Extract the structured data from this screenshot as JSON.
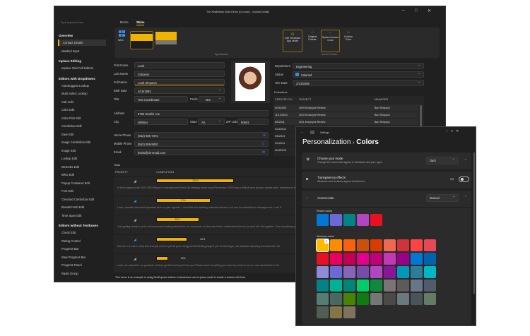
{
  "main": {
    "title": "The XtraEditors Suite Demo (C# code) - Contact Details",
    "search_placeholder": "Type keywords here",
    "sidebar": [
      {
        "type": "h",
        "label": "Overview"
      },
      {
        "type": "i",
        "label": "Contact Details",
        "selected": true
      },
      {
        "type": "i",
        "label": "Masked Input"
      },
      {
        "type": "h",
        "label": "Inplace Editing"
      },
      {
        "type": "i",
        "label": "Inplace Grid Cell Editors"
      },
      {
        "type": "h",
        "label": "Editors with Dropdowns"
      },
      {
        "type": "i",
        "label": "AutoSuggest Lookup"
      },
      {
        "type": "i",
        "label": "Multi Select Lookup"
      },
      {
        "type": "i",
        "label": "Calc Edit"
      },
      {
        "type": "i",
        "label": "Color Edit"
      },
      {
        "type": "i",
        "label": "Color Pick Edit"
      },
      {
        "type": "i",
        "label": "Combobox Edit"
      },
      {
        "type": "i",
        "label": "Date Edit"
      },
      {
        "type": "i",
        "label": "Image Combobox Edit"
      },
      {
        "type": "i",
        "label": "Image Edit"
      },
      {
        "type": "i",
        "label": "Lookup Edit"
      },
      {
        "type": "i",
        "label": "MemoEx Edit"
      },
      {
        "type": "i",
        "label": "MRU Edit"
      },
      {
        "type": "i",
        "label": "Popup Container Edit"
      },
      {
        "type": "i",
        "label": "Font Edit"
      },
      {
        "type": "i",
        "label": "Checked Combobox Edit"
      },
      {
        "type": "i",
        "label": "BreadCrumb Edit"
      },
      {
        "type": "i",
        "label": "Time Span Edit"
      },
      {
        "type": "h",
        "label": "Editors without Textboxes"
      },
      {
        "type": "i",
        "label": "Check Edit"
      },
      {
        "type": "i",
        "label": "Rating Control"
      },
      {
        "type": "i",
        "label": "Progress Bar"
      },
      {
        "type": "i",
        "label": "Step Progress Bar"
      },
      {
        "type": "i",
        "label": "Progress Panel"
      },
      {
        "type": "i",
        "label": "Radio Group"
      }
    ],
    "tabs": [
      "Demo",
      "Skins"
    ],
    "ribbon": {
      "skin_label": "Wi11",
      "appearance": "Appearance",
      "app_mode": "Use Windows App Mode",
      "original_palette": "Original Palette",
      "system_accent": "System Accent Color",
      "custom_color": "Custom Color",
      "accent_colors": "Accent Colors"
    },
    "form": {
      "first_name_label": "First Name",
      "first_name": "Leah",
      "last_name_label": "Last Name",
      "last_name": "Simpson",
      "full_name_label": "Full Name",
      "full_name": "Leah Simpson",
      "birth_date_label": "Birth Date",
      "birth_date": "4/16/1983",
      "title_label": "Title",
      "title": "Test Coordinator",
      "prefix_label": "Prefix",
      "prefix": "Mrs",
      "address_label": "Address",
      "address": "6755 Newlin Ave",
      "city_label": "City",
      "city": "Whittier",
      "state_label": "State",
      "state": "AK",
      "zip_label": "ZIP code",
      "zip": "90601",
      "home_phone_label": "Home Phone",
      "home_phone": "(562) 555-7372",
      "mobile_phone_label": "Mobile Phone",
      "mobile_phone": "(562) 555-5830",
      "email_label": "Email",
      "email": "leahs@dx-email.com",
      "department_label": "Department",
      "department": "Engineering",
      "status_label": "Status",
      "status": "Salaried",
      "hire_date_label": "Hire Date",
      "hire_date": "2/14/2009"
    },
    "evaluations": {
      "label": "Evaluations",
      "columns": [
        "CREATED ON",
        "SUBJECT",
        "MANAGER"
      ],
      "rows": [
        [
          "9/19/2009",
          "2009 Employee Review",
          "Bart Simpson"
        ],
        [
          "11/12/2010",
          "2010 Employee Review",
          "Bart Simpson"
        ],
        [
          "6/5/2011",
          "2011 Employee Review",
          "Bart Simpson"
        ],
        [
          "3/14/2012",
          "",
          ""
        ],
        [
          "9/5/2013",
          "",
          ""
        ],
        [
          "2/1/2014",
          "",
          ""
        ],
        [
          "8/19/2015",
          "",
          ""
        ]
      ]
    },
    "tasks": {
      "label": "Tasks",
      "columns": [
        "PRIORITY",
        "COMPLETION"
      ],
      "rows": [
        {
          "completion": 100,
          "text": "100%",
          "desc": "In final stages of the 2021 R&D Report to Management.Need QA strategy report asap.Remember, 2022 was a difficult year product quality-wise. remedies to issues we encountered."
        },
        {
          "completion": 70,
          "text": "70%",
          "desc": "Leah, consider this most important item on your agenda. I need this new training material reviewed so it can be submitted to management. Leah S"
        },
        {
          "completion": 55,
          "text": "55%",
          "desc": "Just getting ready to push out some new training material for our customers so they can better understand how our product line fits together. Can everything and it looks really nice."
        },
        {
          "completion": 40,
          "text": "40%",
          "desc": "We are in a rush to ship this and you need to put all your energy behind finding bugs.If you do find bugs, use standard reporting mechanisms. We"
        },
        {
          "completion": 15,
          "text": "15%",
          "desc": "Leah, we cannot fix our products until we get the test report from you.Please send everything you have by email to me so I can distribute it in the"
        }
      ]
    },
    "footer": "This demo is an example of using DevExpress editors in standalone and in-place mode to create a custom edit form."
  },
  "settings": {
    "app": "Settings",
    "breadcrumb": "Personalization",
    "page": "Colors",
    "mode_title": "Choose your mode",
    "mode_desc": "Change the colors that appear in Windows and your apps",
    "mode_value": "Dark",
    "transp_title": "Transparency effects",
    "transp_desc": "Windows and surfaces appear translucent",
    "transp_value": "Off",
    "accent_title": "Accent color",
    "accent_value": "Manual",
    "recent_label": "Recent colors",
    "recent": [
      "#0078d4",
      "#6b69d6",
      "#038387",
      "#b146c2",
      "#e81123"
    ],
    "windows_label": "Windows colors",
    "windows": [
      "#ffb900",
      "#ff8c00",
      "#f7630c",
      "#ca5010",
      "#da3b01",
      "#ef6950",
      "#d13438",
      "#ff4343",
      "#e74856",
      "#e81123",
      "#ea005e",
      "#c30052",
      "#e3008c",
      "#bf0077",
      "#c239b3",
      "#9a0089",
      "#0078d4",
      "#0063b1",
      "#8e8cd8",
      "#6b69d6",
      "#8764b8",
      "#744da9",
      "#b146c2",
      "#881798",
      "#0099bc",
      "#2d7d9a",
      "#00b7c3",
      "#038387",
      "#00b294",
      "#018574",
      "#00cc6a",
      "#10893e",
      "#7a7574",
      "#5d5a58",
      "#68768a",
      "#515c6b",
      "#567c73",
      "#486860",
      "#498205",
      "#107c10",
      "#767676",
      "#4c4a48",
      "#69797e",
      "#4a5459",
      "#647c64",
      "#525e54",
      "#847545",
      "#7e735f"
    ],
    "selected": 0
  },
  "colors": {
    "accent": "#f0b400",
    "blue": "#3a8de0"
  }
}
